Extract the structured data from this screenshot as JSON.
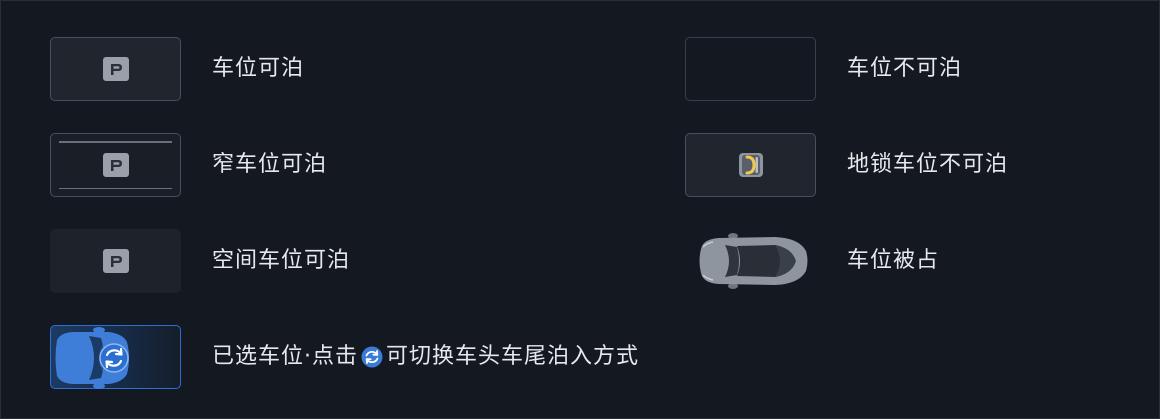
{
  "legend": {
    "available": {
      "label": "车位可泊"
    },
    "unavailable": {
      "label": "车位不可泊"
    },
    "narrow": {
      "label": "窄车位可泊"
    },
    "ground_lock": {
      "label": "地锁车位不可泊"
    },
    "space": {
      "label": "空间车位可泊"
    },
    "occupied": {
      "label": "车位被占"
    },
    "selected": {
      "label_before": "已选车位·点击",
      "label_after": "可切换车头车尾泊入方式"
    }
  },
  "icons": {
    "parking": "parking-p-icon",
    "ground_lock": "ground-lock-icon",
    "occupied_car": "car-top-view-icon",
    "switch": "switch-direction-icon"
  },
  "colors": {
    "background": "#141821",
    "tile_fill": "#20252e",
    "tile_border": "#4a505b",
    "selected_accent": "#2b6fd1",
    "lock_yellow": "#f2c94c",
    "text": "#e6e8ec"
  }
}
